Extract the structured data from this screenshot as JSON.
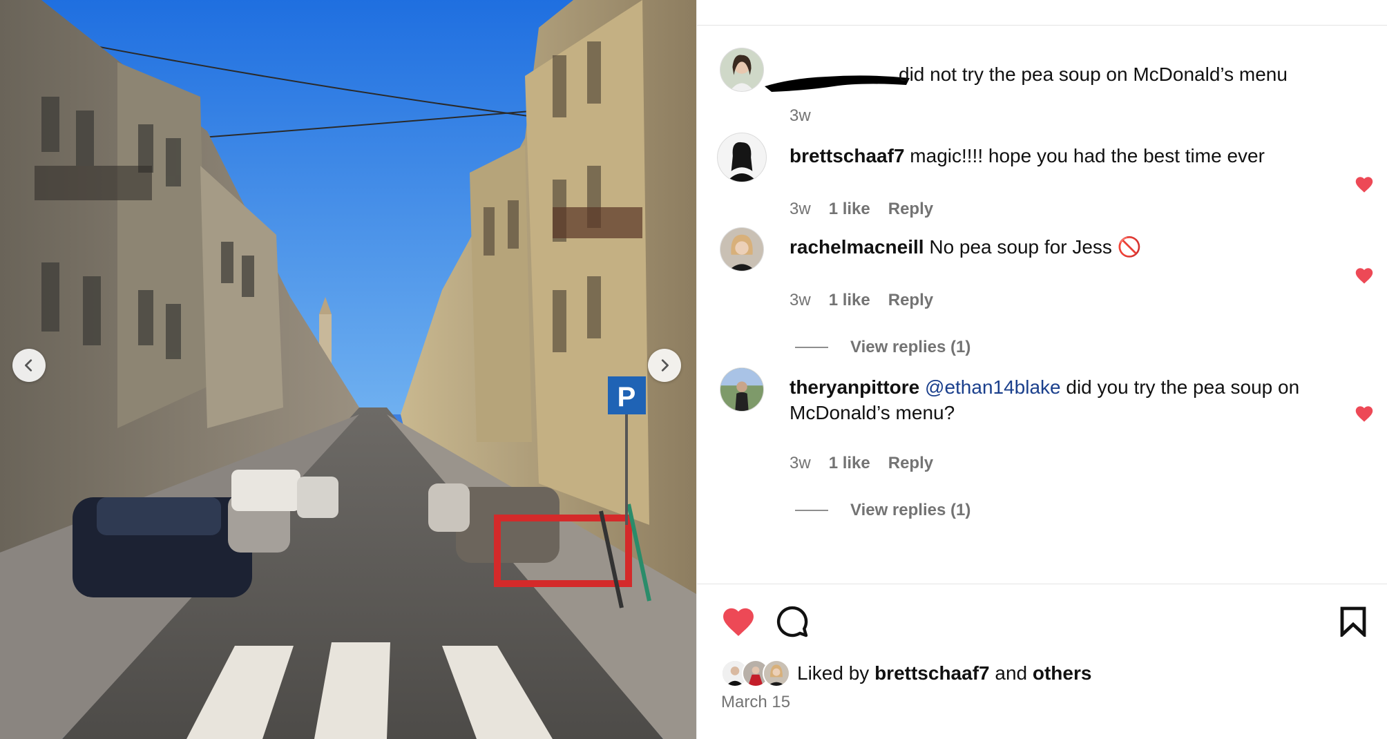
{
  "post": {
    "caption_text": "did not try the pea soup on McDonald’s menu",
    "caption_time": "3w",
    "comments": [
      {
        "username": "brettschaaf7",
        "text": "magic!!!! hope you had the best time ever",
        "time": "3w",
        "likes": "1 like",
        "reply": "Reply"
      },
      {
        "username": "rachelmacneill",
        "text": "No pea soup for Jess 🚫",
        "time": "3w",
        "likes": "1 like",
        "reply": "Reply",
        "view_replies": "View replies (1)"
      },
      {
        "username": "theryanpittore",
        "mention": "@ethan14blake",
        "text": " did you try the pea soup on McDonald’s menu?",
        "time": "3w",
        "likes": "1 like",
        "reply": "Reply",
        "view_replies": "View replies (1)"
      }
    ],
    "likes": {
      "prefix": "Liked by ",
      "user": "brettschaaf7",
      "middle": " and ",
      "others": "others"
    },
    "date": "March 15"
  },
  "icons": {
    "carousel_prev": "chevron-left-icon",
    "carousel_next": "chevron-right-icon",
    "like": "heart-icon",
    "comment": "comment-icon",
    "save": "bookmark-icon"
  },
  "colors": {
    "heart": "#ed4956",
    "mention": "#1a3f8c",
    "muted": "#737373"
  }
}
